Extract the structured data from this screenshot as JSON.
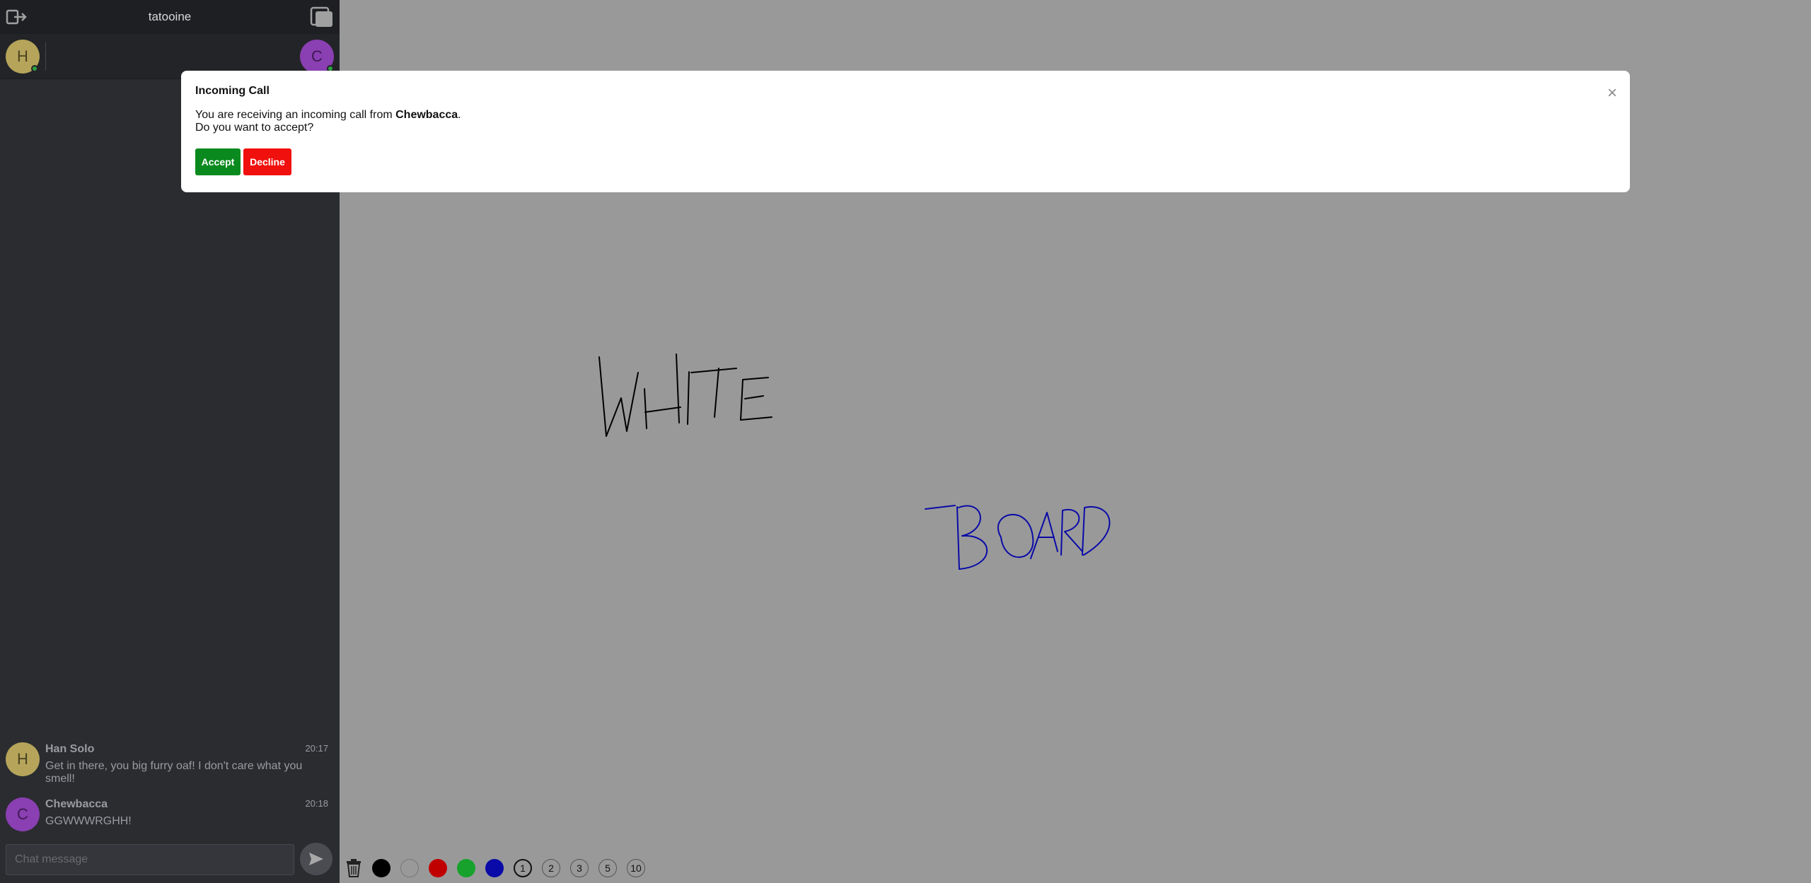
{
  "sidebar": {
    "room_title": "tatooine",
    "leave_icon": "leave-room-icon",
    "popout_icon": "popout-window-icon",
    "presence": [
      {
        "initial": "H",
        "status": "online"
      },
      {
        "initial": "C",
        "status": "online"
      }
    ],
    "messages": [
      {
        "initial": "H",
        "author": "Han Solo",
        "time": "20:17",
        "text": "Get in there, you big furry oaf! I don't care what you smell!"
      },
      {
        "initial": "C",
        "author": "Chewbacca",
        "time": "20:18",
        "text": "GGWWWRGHH!"
      }
    ],
    "composer": {
      "placeholder": "Chat message",
      "value": ""
    }
  },
  "whiteboard": {
    "toolbar": {
      "trash_icon": "trash-icon",
      "colors": [
        "#000000",
        "#999999",
        "#c00000",
        "#16a22c",
        "#0a0aa8"
      ],
      "sizes": [
        "1",
        "2",
        "3",
        "5",
        "10"
      ],
      "selected_size": "1"
    },
    "drawing_text": [
      "WHITE",
      "BOARD"
    ]
  },
  "modal": {
    "title": "Incoming Call",
    "body_prefix": "You are receiving an incoming call from ",
    "caller": "Chewbacca",
    "body_suffix": ".",
    "question": "Do you want to accept?",
    "close_symbol": "×",
    "accept_label": "Accept",
    "decline_label": "Decline"
  }
}
